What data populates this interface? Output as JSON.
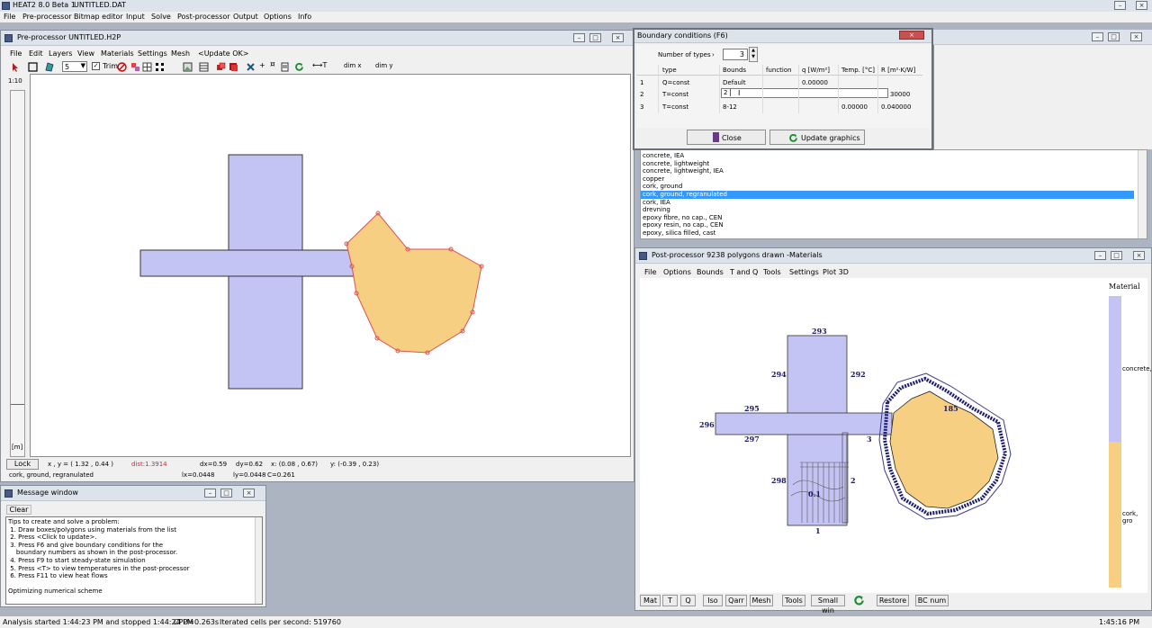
{
  "app": {
    "title": "HEAT2 8.0 Beta 1",
    "file": "UNTITLED.DAT",
    "menu": [
      "File",
      "Pre-processor",
      "Bitmap editor",
      "Input",
      "Solve",
      "Post-processor",
      "Output",
      "Options",
      "Info"
    ]
  },
  "pre": {
    "title": "Pre-processor  UNTITLED.H2P",
    "menu": [
      "File",
      "Edit",
      "Layers",
      "View",
      "Materials",
      "Settings",
      "Mesh",
      "<Update OK>"
    ],
    "layer_value": "5",
    "trim_label": "Trim",
    "dimx": "dim x",
    "dimy": "dim y",
    "scale": "1:10",
    "unit": "[m]",
    "status": {
      "lock": "Lock",
      "xy": "x , y = ( 1.32 ,  0.44 )",
      "dist": "dist:1.3914",
      "dx": "dx=0.59",
      "dy": "dy=0.62",
      "x": "x:  (0.08 ,  0.67)",
      "y": "y:  (-0.39 ,  0.23)",
      "material": "cork, ground, regranulated",
      "lx": "lx=0.0448",
      "ly": "ly=0.0448",
      "c": "C=0.261"
    }
  },
  "msg": {
    "title": "Message window",
    "clear": "Clear",
    "lines": [
      "Tips to create and solve a problem:",
      " 1. Draw boxes/polygons using materials from the list",
      " 2. Press <Click to update>.",
      " 3. Press F6 and give boundary conditions for the",
      "    boundary numbers as shown in the post-processor.",
      " 4. Press F9 to start steady-state simulation",
      " 5. Press <T> to view temperatures in the post-processor",
      " 6. Press F11 to view heat flows",
      "",
      "Optimizing numerical scheme"
    ]
  },
  "bc": {
    "title": "Boundary conditions (F6)",
    "num_types_label": "Number of types",
    "num_types_value": "3",
    "headers": [
      "type",
      "Bounds",
      "function",
      "q [W/m²]",
      "Temp. [°C]",
      "R [m²·K/W]"
    ],
    "rows": [
      {
        "n": "1",
        "type": "Q=const",
        "bounds": "Default",
        "func": "",
        "q": "0.00000",
        "temp": "",
        "r": ""
      },
      {
        "n": "2",
        "type": "T=const",
        "bounds": "2",
        "func": "",
        "q": "",
        "temp": "",
        "r": "30000"
      },
      {
        "n": "3",
        "type": "T=const",
        "bounds": "8-12",
        "func": "",
        "q": "",
        "temp": "0.00000",
        "r": "0.040000"
      }
    ],
    "close": "Close",
    "update": "Update graphics"
  },
  "materials": {
    "items": [
      "concrete, IEA",
      "concrete, lightweight",
      "concrete, lightweight, IEA",
      "copper",
      "cork, ground",
      "cork, ground, regranulated",
      "cork, IEA",
      "drevning",
      "epoxy fibre, no cap., CEN",
      "epoxy resin, no cap., CEN",
      "epoxy, silica filled, cast"
    ],
    "selected_index": 5
  },
  "post": {
    "title": "Post-processor 9238 polygons drawn -Materials",
    "menu": [
      "File",
      "Options",
      "Bounds",
      "T and Q",
      "Tools",
      "Settings",
      "Plot 3D"
    ],
    "legend_title": "Material",
    "legend_items": [
      "concrete,",
      "cork, gro"
    ],
    "boundary_numbers": [
      "293",
      "294",
      "292",
      "295",
      "296",
      "297",
      "298",
      "2",
      "1",
      "3",
      "185",
      "0.1"
    ],
    "buttons": [
      "Mat",
      "T",
      "Q",
      "Iso",
      "Qarr",
      "Mesh",
      "Tools",
      "Small win",
      "Restore",
      "BC num"
    ]
  },
  "status": {
    "analysis": "Analysis started 1:44:23 PM and stopped 1:44:24 PM",
    "cpu": "CPU=0.263s",
    "iter": "Iterated cells per second: 519760",
    "time": "1:45:16 PM"
  },
  "colors": {
    "concrete": "#c4c4f4",
    "cork": "#f6cf82",
    "selection": "#3399ff",
    "bc_blue": "#1c1c6e"
  }
}
